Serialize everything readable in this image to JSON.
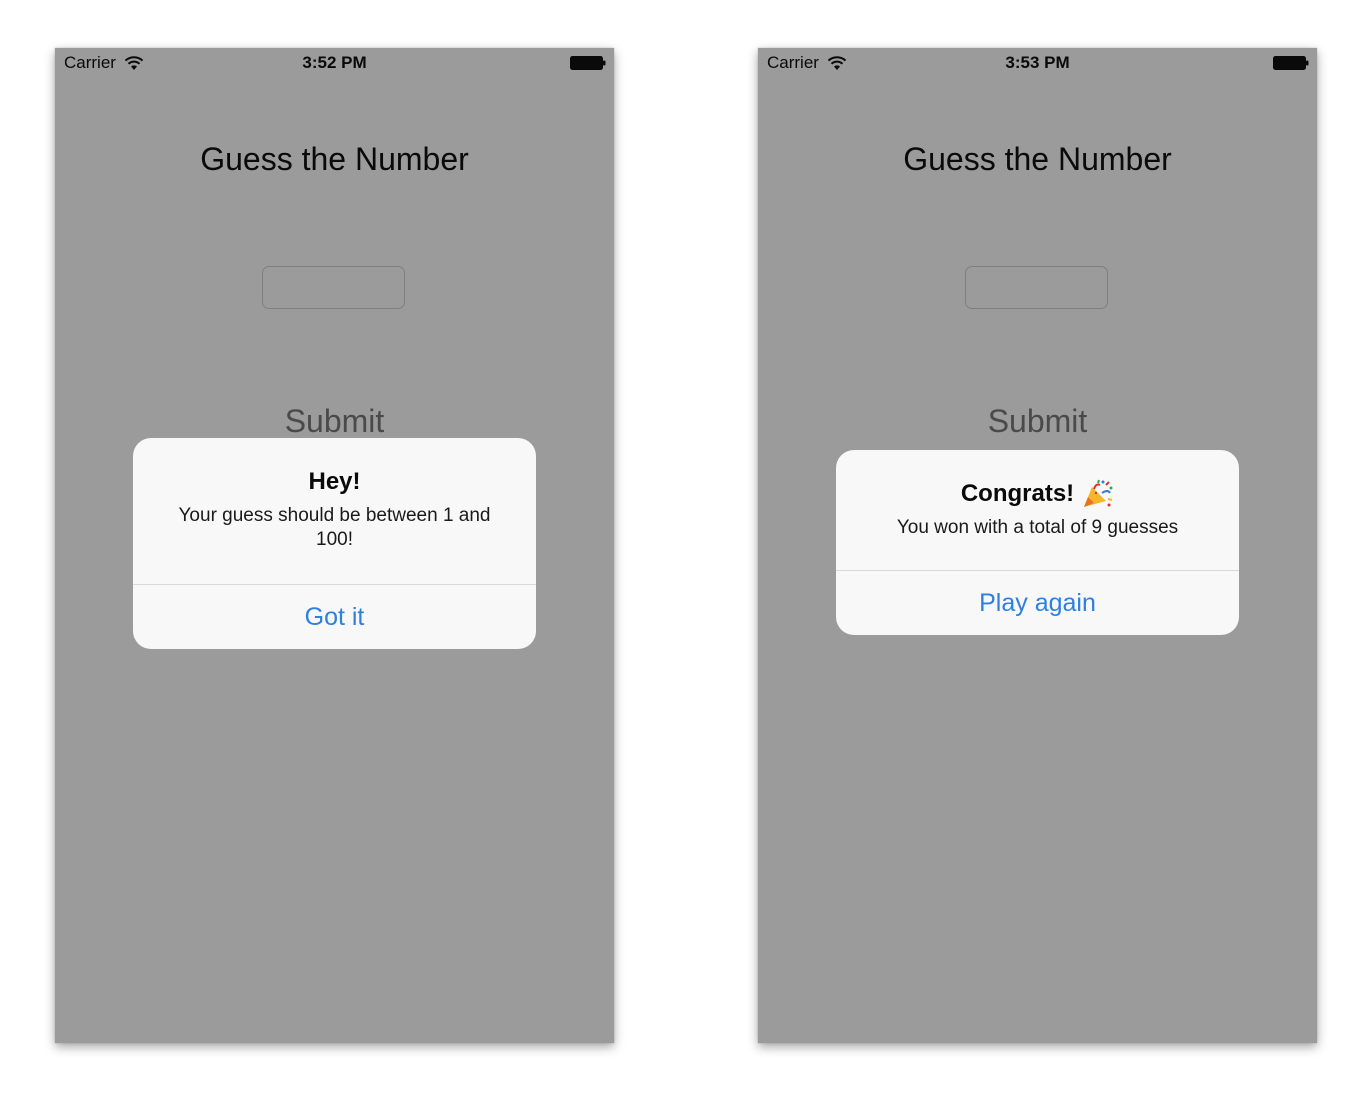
{
  "screens": [
    {
      "status": {
        "carrier": "Carrier",
        "time": "3:52 PM"
      },
      "title": "Guess the Number",
      "input": {
        "value": ""
      },
      "submit_label": "Submit",
      "alert": {
        "title": "Hey!",
        "message": "Your guess should be between 1 and 100!",
        "action": "Got it"
      }
    },
    {
      "status": {
        "carrier": "Carrier",
        "time": "3:53 PM"
      },
      "title": "Guess the Number",
      "input": {
        "value": ""
      },
      "submit_label": "Submit",
      "alert": {
        "title": "Congrats!",
        "title_icon": "party-popper-icon",
        "message": "You won with a total of 9 guesses",
        "action": "Play again"
      }
    }
  ],
  "colors": {
    "accent": "#2d7fe0",
    "dimmed_background": "#9b9b9b",
    "alert_background": "#f8f8f8"
  }
}
